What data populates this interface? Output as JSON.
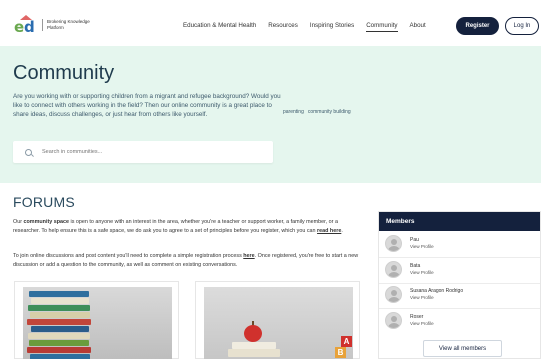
{
  "logo": {
    "text": "Brokering Knowledge Platform"
  },
  "nav": {
    "items": [
      {
        "label": "Education & Mental Health"
      },
      {
        "label": "Resources"
      },
      {
        "label": "Inspiring Stories"
      },
      {
        "label": "Community"
      },
      {
        "label": "About"
      }
    ],
    "register_label": "Register",
    "login_label": "Log In"
  },
  "hero": {
    "title": "Community",
    "text": "Are you working with or supporting children from a migrant and refugee background? Would you like to connect with others working in the field? Then our online community is a great place to share ideas, discuss challenges, or just hear from others like yourself.",
    "tags": [
      "parenting",
      "community building"
    ],
    "search_placeholder": "Search in communities..."
  },
  "forums": {
    "title": "FORUMS",
    "p1_a": "Our ",
    "p1_b": "community space",
    "p1_c": " is open to anyone with an interest in the area, whether you're a teacher or support worker, a family member, or a researcher. To help ensure this is a safe space, we do ask you to agree to a set of principles before you register, which you can ",
    "p1_link": "read here",
    "p1_d": ".",
    "p2_a": "To join online discussions and post content you'll need to complete a simple registration process ",
    "p2_link": "here",
    "p2_b": ". Once registered, you're free to start a new discussion or add a question to the community, as well as comment on existing conversations."
  },
  "members": {
    "title": "Members",
    "list": [
      {
        "name": "Pau",
        "link": "View Profile"
      },
      {
        "name": "Bata",
        "link": "View Profile"
      },
      {
        "name": "Susana Aragon Rodrigo",
        "link": "View Profile"
      },
      {
        "name": "Roser",
        "link": "View Profile"
      }
    ],
    "view_all_label": "View all members"
  },
  "colors": {
    "hero_bg": "#e5f6ee",
    "navy": "#14213d",
    "title": "#1f3b4d"
  }
}
